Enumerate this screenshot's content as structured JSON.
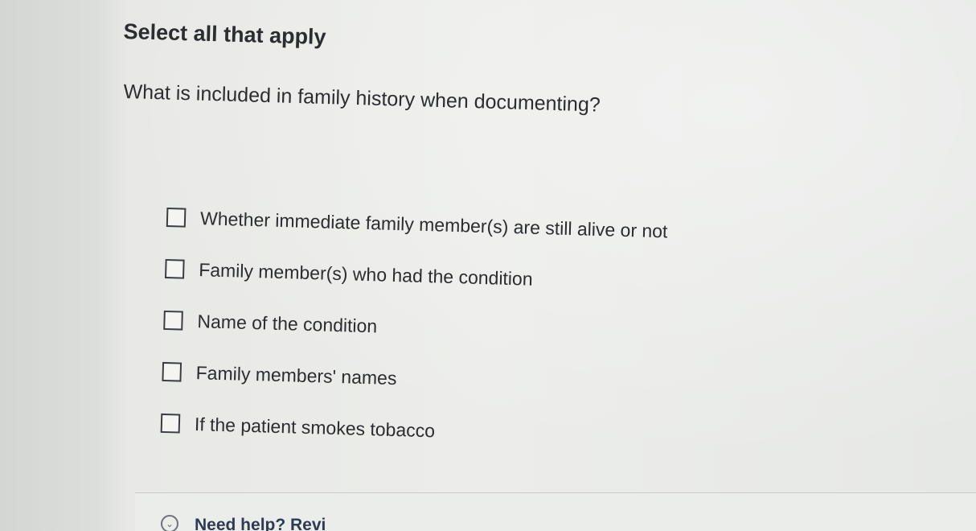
{
  "prompt": {
    "instruction": "Select all that apply",
    "question": "What is included in family history when documenting?"
  },
  "options": [
    {
      "label": "Whether immediate family member(s) are still alive or not",
      "checked": false
    },
    {
      "label": "Family member(s) who had the condition",
      "checked": false
    },
    {
      "label": "Name of the condition",
      "checked": false
    },
    {
      "label": "Family members' names",
      "checked": false
    },
    {
      "label": "If the patient smokes tobacco",
      "checked": false
    }
  ],
  "help": {
    "icon": "chevron-down-circle-icon",
    "label": "Need help? Revi"
  }
}
